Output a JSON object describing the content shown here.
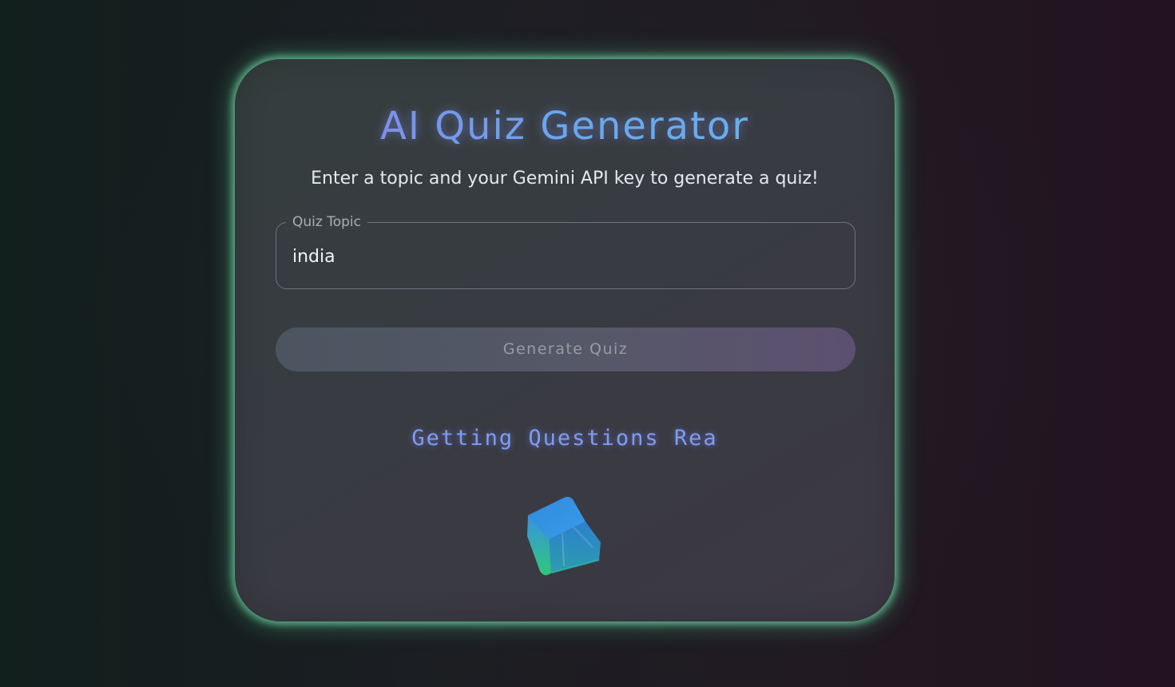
{
  "app": {
    "title": "AI Quiz Generator",
    "subtitle": "Enter a topic and your Gemini API key to generate a quiz!"
  },
  "form": {
    "topic_label": "Quiz Topic",
    "topic_value": "india",
    "generate_label": "Generate Quiz"
  },
  "status": {
    "loading_text": "Getting Questions Rea",
    "loader_icon": "cube-loader-icon"
  },
  "colors": {
    "card_glow": "#6ee1aa",
    "title_gradient_start": "#8c7fe6",
    "title_gradient_end": "#64b8f0",
    "loading_text": "#7f9cf0",
    "cube_top": "#2f8fe8",
    "cube_bottom": "#2ed07a"
  }
}
